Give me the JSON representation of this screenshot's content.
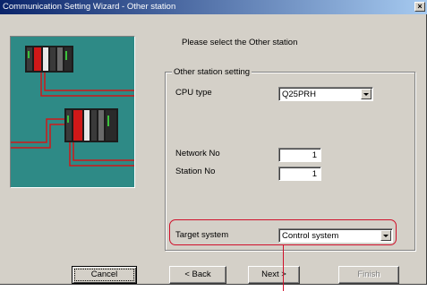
{
  "window": {
    "title": "Communication Setting Wizard - Other station",
    "close_label": "×"
  },
  "prompt": "Please select the Other station",
  "group": {
    "title": "Other station setting",
    "cpu_type_label": "CPU type",
    "cpu_type_value": "Q25PRH",
    "network_no_label": "Network No",
    "network_no_value": "1",
    "station_no_label": "Station No",
    "station_no_value": "1",
    "target_system_label": "Target system",
    "target_system_value": "Control system"
  },
  "buttons": {
    "cancel": "Cancel",
    "back": "< Back",
    "next": "Next >",
    "finish": "Finish"
  },
  "colors": {
    "titlebar_start": "#0a246a",
    "titlebar_end": "#a6caf0",
    "illustration_bg": "#2e8a86",
    "highlight": "#d0102a",
    "dialog_face": "#d4d0c8"
  }
}
